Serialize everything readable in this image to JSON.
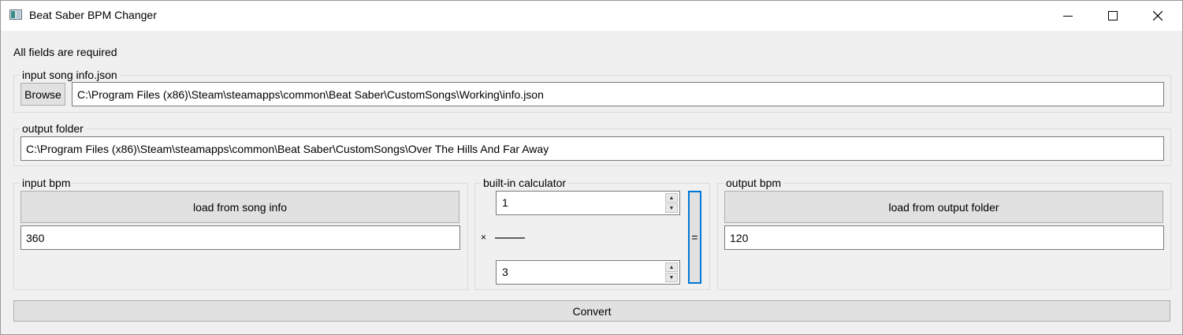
{
  "window": {
    "title": "Beat Saber BPM Changer",
    "controls": {
      "minimize": "minimize-icon",
      "maximize": "maximize-icon",
      "close": "close-icon"
    }
  },
  "notice": "All fields are required",
  "input_song": {
    "group_label": "input song info.json",
    "browse_label": "Browse",
    "path_value": "C:\\Program Files (x86)\\Steam\\steamapps\\common\\Beat Saber\\CustomSongs\\Working\\info.json"
  },
  "output_folder": {
    "group_label": "output folder",
    "path_value": "C:\\Program Files (x86)\\Steam\\steamapps\\common\\Beat Saber\\CustomSongs\\Over The Hills And Far Away"
  },
  "input_bpm": {
    "group_label": "input bpm",
    "load_button_label": "load from song info",
    "value": "360"
  },
  "calculator": {
    "group_label": "built-in calculator",
    "numerator": "1",
    "denominator": "3",
    "multiply_symbol": "×",
    "equals_label": "="
  },
  "output_bpm": {
    "group_label": "output bpm",
    "load_button_label": "load from output folder",
    "value": "120"
  },
  "convert_label": "Convert",
  "colors": {
    "focus_accent": "#0078d7",
    "window_bg": "#f0f0f0",
    "button_bg": "#e1e1e1"
  }
}
